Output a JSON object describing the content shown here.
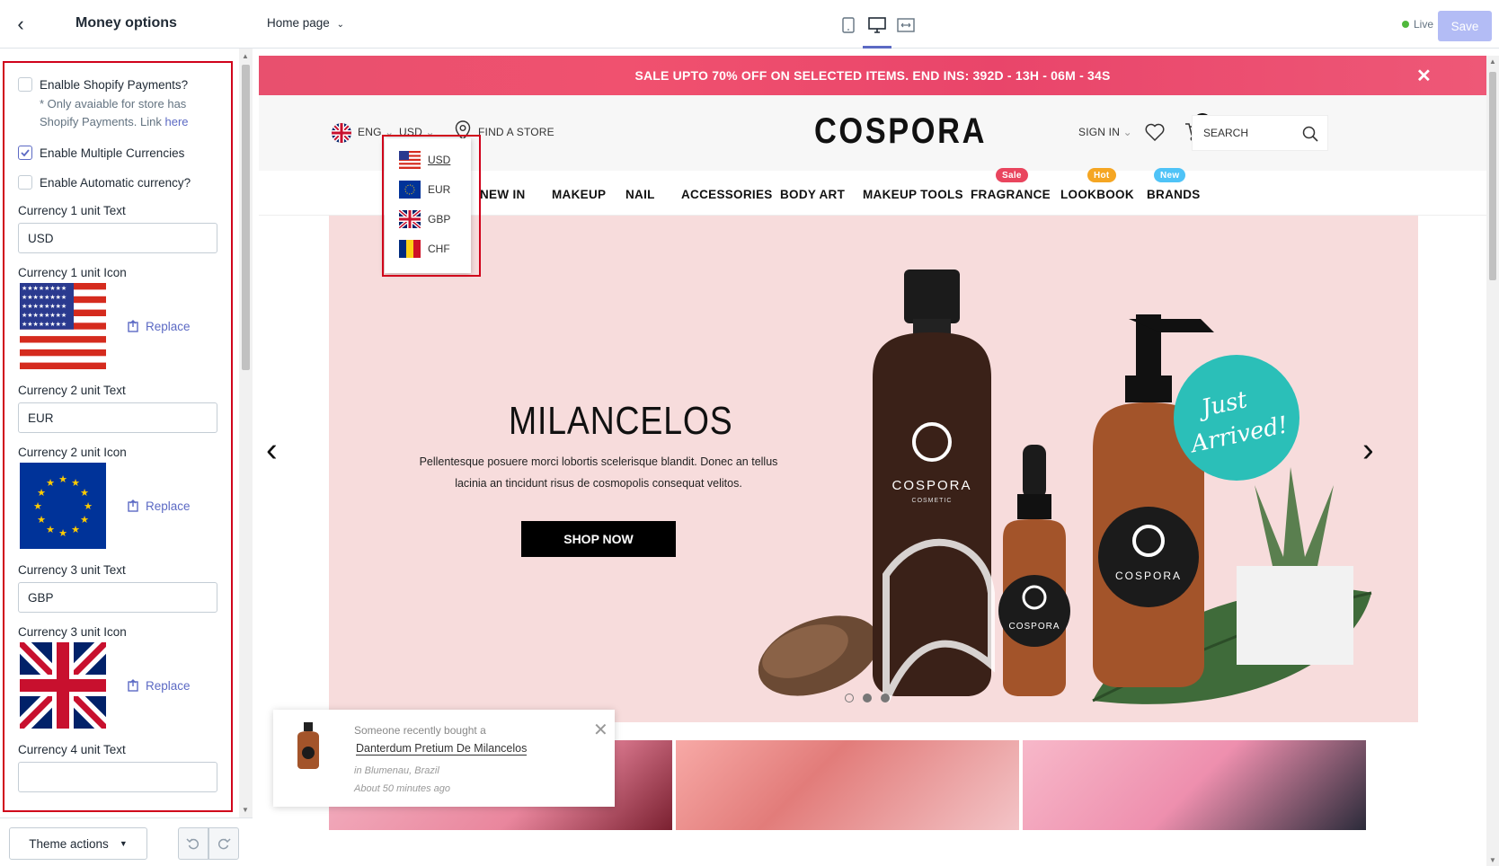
{
  "sidebar": {
    "title": "Money options",
    "enable_payments_label": "Enalble Shopify Payments?",
    "payments_note": "* Only avaiable for store has Shopify Payments.",
    "payments_link_prefix": "Link",
    "payments_link": "here",
    "enable_multi_label": "Enable Multiple Currencies",
    "enable_auto_label": "Enable Automatic currency?",
    "currencies": [
      {
        "text_label": "Currency 1 unit Text",
        "value": "USD",
        "icon_label": "Currency 1 unit Icon",
        "flag": "us-flag"
      },
      {
        "text_label": "Currency 2 unit Text",
        "value": "EUR",
        "icon_label": "Currency 2 unit Icon",
        "flag": "eu-flag"
      },
      {
        "text_label": "Currency 3 unit Text",
        "value": "GBP",
        "icon_label": "Currency 3 unit Icon",
        "flag": "uk-flag"
      },
      {
        "text_label": "Currency 4 unit Text"
      }
    ],
    "replace_label": "Replace",
    "theme_actions": "Theme actions"
  },
  "topbar": {
    "page": "Home page",
    "live": "Live",
    "save": "Save"
  },
  "store": {
    "promo": "SALE UPTO 70% OFF ON SELECTED ITEMS. END INS:  392D - 13H - 06M - 34S",
    "lang": "ENG",
    "currency": "USD",
    "find_store": "FIND A STORE",
    "logo": "COSPORA",
    "sign_in": "SIGN IN",
    "cart_count": "2",
    "search": "SEARCH",
    "nav": [
      {
        "label": "NEW IN"
      },
      {
        "label": "MAKEUP"
      },
      {
        "label": "NAIL"
      },
      {
        "label": "ACCESSORIES"
      },
      {
        "label": "BODY ART"
      },
      {
        "label": "MAKEUP TOOLS"
      },
      {
        "label": "FRAGRANCE",
        "tag": "Sale"
      },
      {
        "label": "LOOKBOOK",
        "tag": "Hot"
      },
      {
        "label": "BRANDS",
        "tag": "New"
      }
    ],
    "currency_options": [
      "USD",
      "EUR",
      "GBP",
      "CHF"
    ],
    "hero_title": "MILANCELOS",
    "hero_text": "Pellentesque posuere morci lobortis scelerisque blandit. Donec an tellus lacinia an tincidunt risus de cosmopolis consequat velitos.",
    "shop_now": "SHOP NOW",
    "bottle_brand": "COSPORA",
    "bottle_sub": "COSMETIC",
    "sticker_line1": "Just",
    "sticker_line2": "Arrived!",
    "toast": {
      "line1": "Someone recently bought a",
      "product": "Danterdum Pretium De Milancelos",
      "location": "in Blumenau, Brazil",
      "time": "About 50 minutes ago"
    }
  },
  "colors": {
    "accent": "#5c6ac4",
    "highlight_border": "#d0021b",
    "sale_tag": "#e9455e",
    "hot_tag": "#f5a623",
    "new_tag": "#4fc3f7",
    "sticker": "#2bbfb8"
  }
}
